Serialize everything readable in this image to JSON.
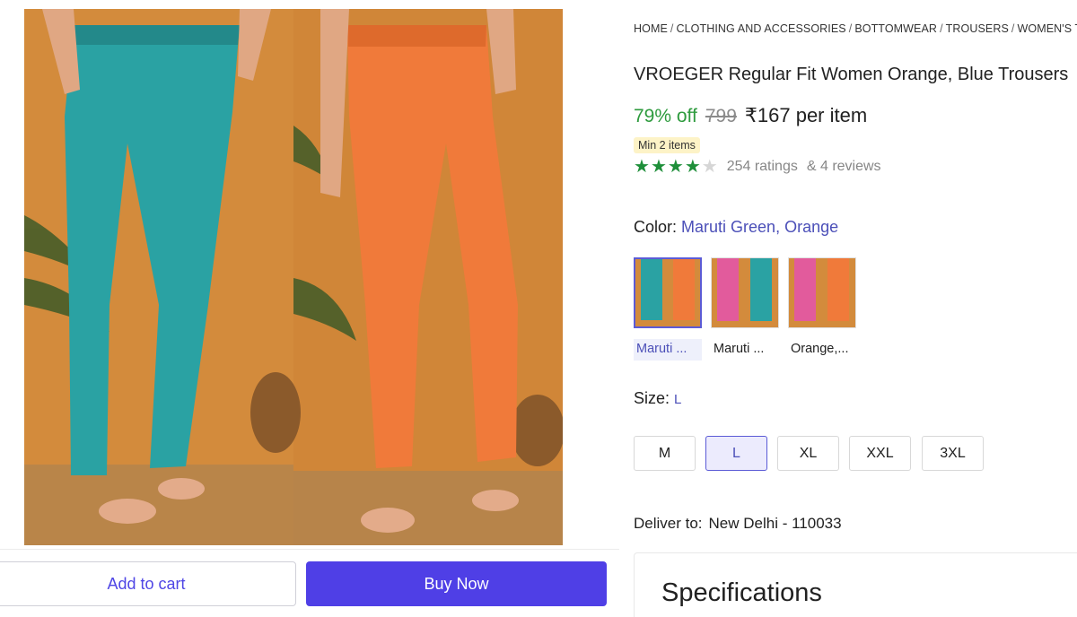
{
  "product_image": {
    "alt_icon": "product-photo",
    "colors": {
      "left_trouser": "#2aa2a3",
      "right_trouser": "#f07a3a",
      "backdrop": "#d38b3c",
      "floor": "#b98549"
    }
  },
  "actions": {
    "add_to_cart": "Add to cart",
    "buy_now": "Buy Now"
  },
  "breadcrumb": [
    "HOME",
    "CLOTHING AND ACCESSORIES",
    "BOTTOMWEAR",
    "TROUSERS",
    "WOMEN'S TROUSERS"
  ],
  "product": {
    "title": "VROEGER Regular Fit Women Orange, Blue Trousers",
    "discount": "79% off",
    "mrp": "799",
    "price": "₹167 per item",
    "min_items": "Min 2 items",
    "rating_stars": 4,
    "rating_max": 5,
    "ratings": "254 ratings",
    "reviews": "& 4 reviews"
  },
  "color": {
    "label": "Color:",
    "selected": "Maruti Green, Orange",
    "options": [
      {
        "label": "Maruti ...",
        "selected": true,
        "left": "#2aa2a3",
        "right": "#f07a3a"
      },
      {
        "label": "Maruti ...",
        "selected": false,
        "left": "#e25b9c",
        "right": "#2aa2a3"
      },
      {
        "label": "Orange,...",
        "selected": false,
        "left": "#e25b9c",
        "right": "#f07a3a"
      }
    ]
  },
  "size": {
    "label": "Size:",
    "selected": "L",
    "options": [
      "M",
      "L",
      "XL",
      "XXL",
      "3XL"
    ]
  },
  "delivery": {
    "label": "Deliver to:",
    "location": "New Delhi - 110033"
  },
  "specifications": {
    "title": "Specifications"
  },
  "accent": {
    "primary": "#4f3fe6",
    "discount_green": "#2e9b3e",
    "star_green": "#1f8f3a"
  }
}
